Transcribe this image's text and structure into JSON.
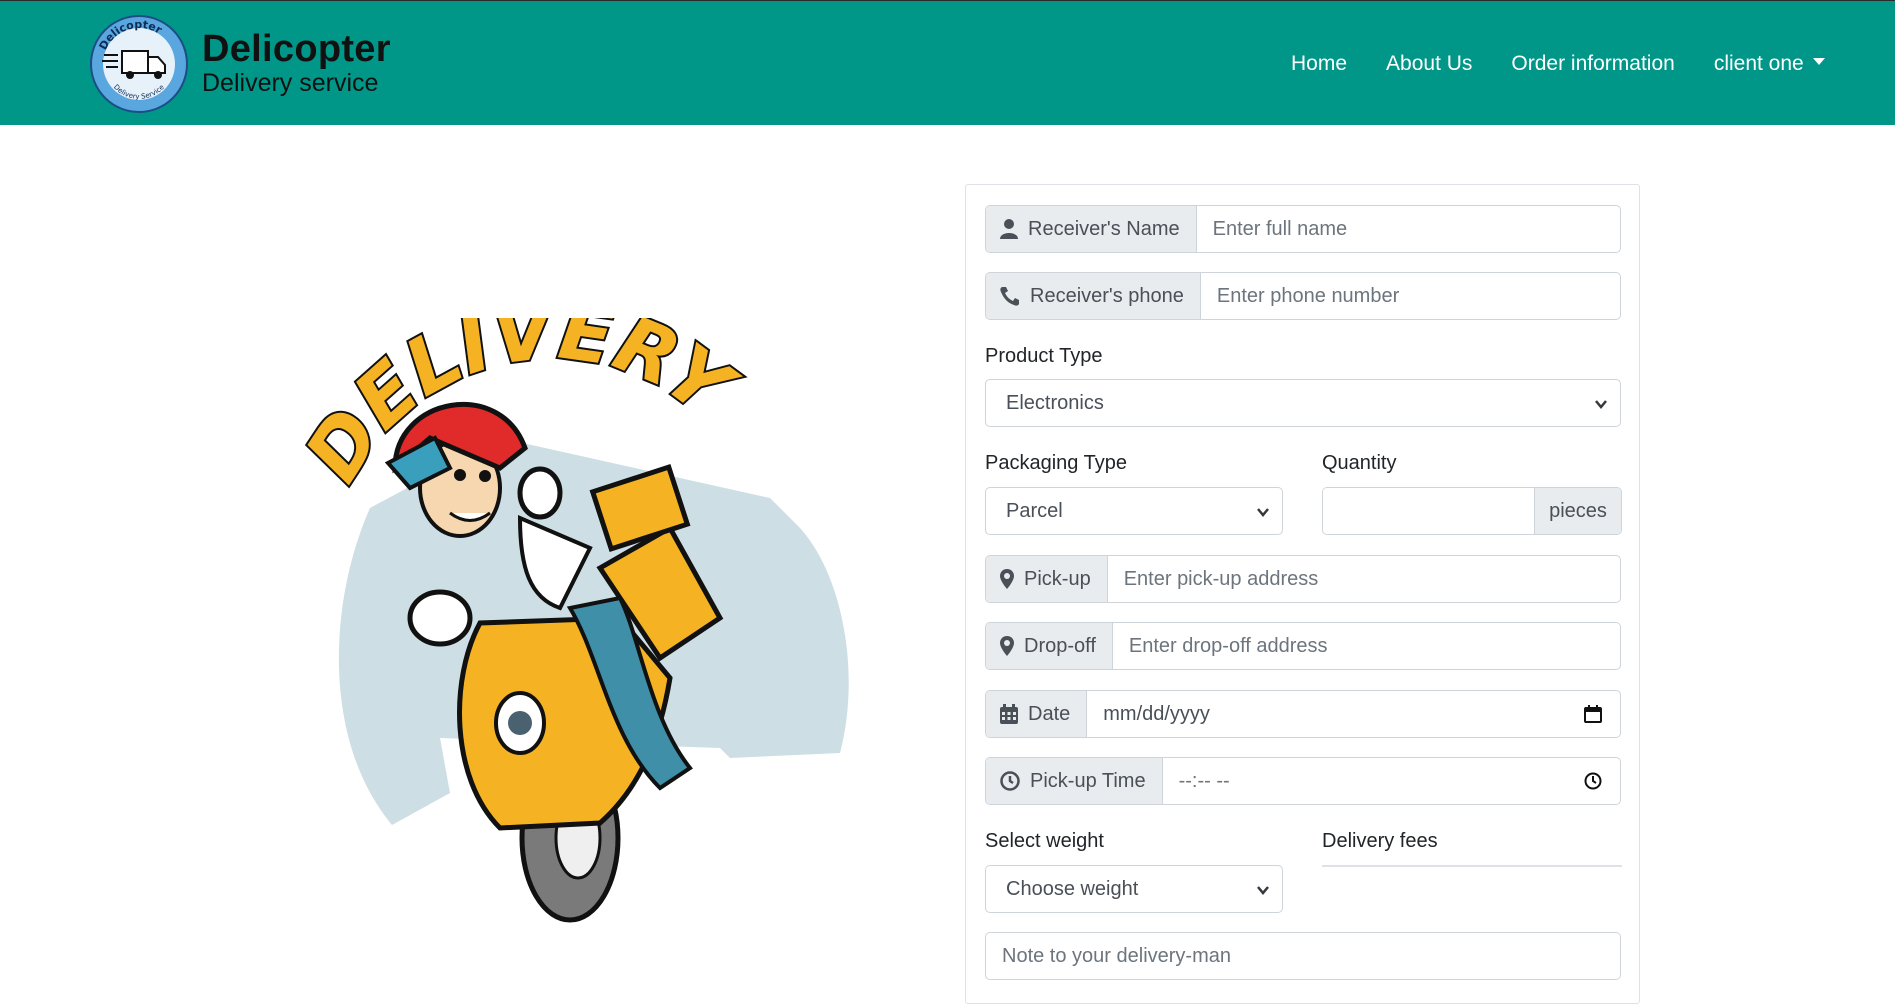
{
  "brand": {
    "name": "Delicopter",
    "tagline": "Delivery service",
    "logo_ring_text": "Delicopter",
    "logo_bottom_text": "Delivery Service"
  },
  "nav": {
    "home": "Home",
    "about": "About Us",
    "orders": "Order information",
    "user": "client one"
  },
  "illustration": {
    "word": "DELIVERY"
  },
  "form": {
    "receiver_name": {
      "label": "Receiver's Name",
      "placeholder": "Enter full name"
    },
    "receiver_phone": {
      "label": "Receiver's phone",
      "placeholder": "Enter phone number"
    },
    "product_type": {
      "label": "Product Type",
      "value": "Electronics"
    },
    "packaging_type": {
      "label": "Packaging Type",
      "value": "Parcel"
    },
    "quantity": {
      "label": "Quantity",
      "unit": "pieces",
      "value": ""
    },
    "pickup": {
      "label": "Pick-up",
      "placeholder": "Enter pick-up address"
    },
    "dropoff": {
      "label": "Drop-off",
      "placeholder": "Enter drop-off address"
    },
    "date": {
      "label": "Date",
      "placeholder": "mm/dd/yyyy"
    },
    "pickup_time": {
      "label": "Pick-up Time",
      "placeholder": "--:-- --"
    },
    "weight": {
      "label": "Select weight",
      "value": "Choose weight"
    },
    "delivery_fees": {
      "label": "Delivery fees",
      "value": ""
    },
    "note": {
      "placeholder": "Note to your delivery-man"
    }
  },
  "colors": {
    "navbar": "#009688",
    "addon_bg": "#e9ecef",
    "border": "#ced4da",
    "scooter": "#f5b324"
  },
  "icons": [
    "user-icon",
    "phone-icon",
    "map-marker-icon",
    "calendar-icon",
    "clock-icon",
    "chevron-down-icon",
    "caret-down-icon"
  ]
}
